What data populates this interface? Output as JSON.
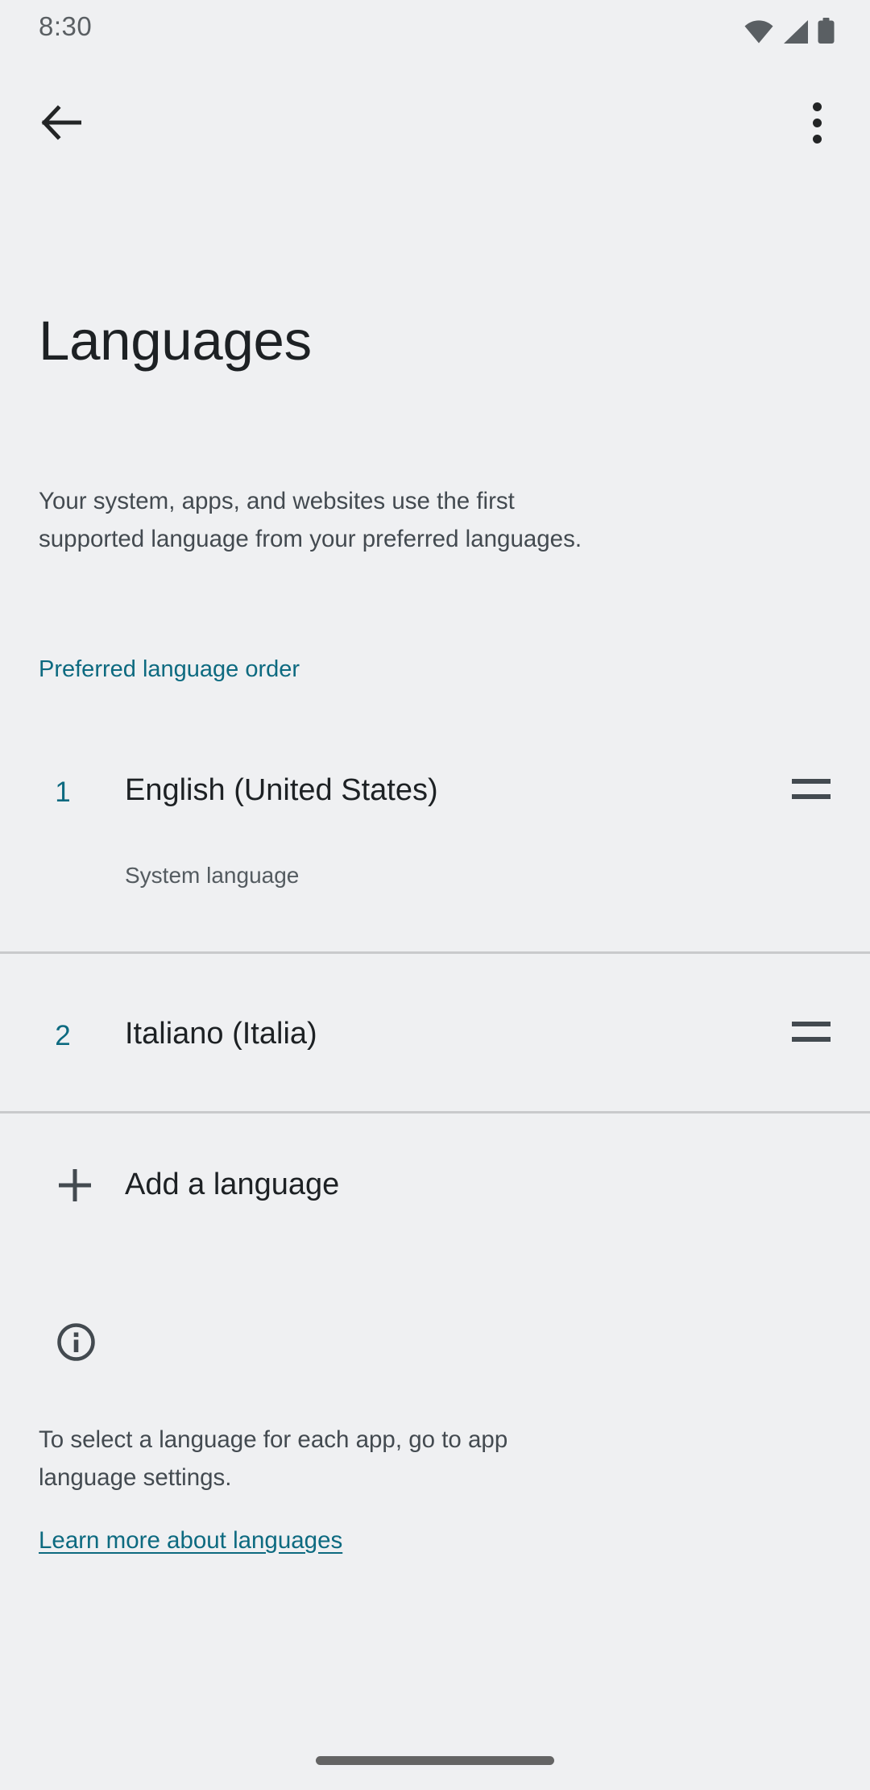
{
  "status_bar": {
    "time": "8:30",
    "icons": [
      "wifi-icon",
      "cell-signal-icon",
      "battery-icon"
    ]
  },
  "app_bar": {
    "back_icon": "back-arrow-icon",
    "overflow_icon": "more-vert-icon"
  },
  "header": {
    "title": "Languages",
    "description": "Your system, apps, and websites use the first supported language from your preferred languages."
  },
  "section": {
    "heading": "Preferred language order"
  },
  "languages": [
    {
      "index": "1",
      "name": "English (United States)",
      "subtitle": "System language",
      "drag_handle": "drag-handle-icon"
    },
    {
      "index": "2",
      "name": "Italiano (Italia)",
      "subtitle": "",
      "drag_handle": "drag-handle-icon"
    }
  ],
  "add_language": {
    "label": "Add a language",
    "icon": "plus-icon"
  },
  "footer": {
    "icon": "info-circle-icon",
    "text": "To select a language for each app, go to app language settings.",
    "link_label": "Learn more about languages"
  },
  "nav": {
    "home_indicator": "home-indicator"
  },
  "colors": {
    "background": "#eff0f2",
    "accent": "#0d6a80",
    "primary_text": "#1d2124",
    "secondary_text": "#434a50",
    "divider": "#c9cacc",
    "icon": "#434a50"
  }
}
